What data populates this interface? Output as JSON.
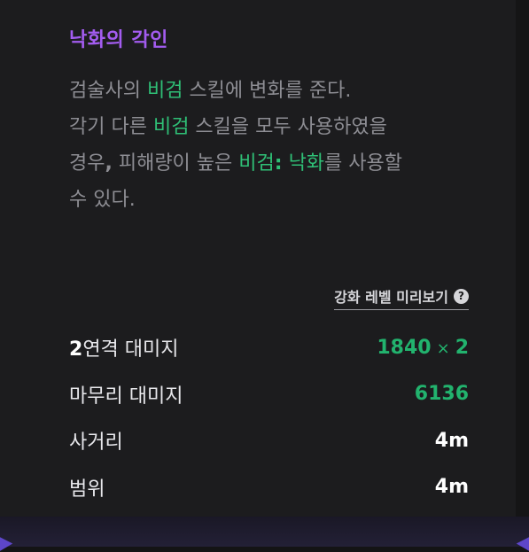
{
  "title": "낙화의 각인",
  "description": {
    "line1": [
      "검술사의 ",
      "비검",
      " 스킬에 변화를 준다."
    ],
    "line2": [
      "각기 다른 ",
      "비검",
      " 스킬을 모두 사용하였을"
    ],
    "line3": [
      "경우",
      ",",
      " 피해량이 높은 ",
      "비검",
      ":",
      " ",
      "낙화",
      "를 사용할"
    ],
    "line4": "수 있다."
  },
  "preview_link": {
    "label": "강화 레벨 미리보기",
    "icon": "?"
  },
  "stats": [
    {
      "label_num": "2",
      "label_rest": "연격 대미지",
      "value_main": "1840",
      "value_times": "×",
      "value_mult": "2"
    },
    {
      "label": "마무리 대미지",
      "value": "6136"
    },
    {
      "label": "사거리",
      "value": "4m"
    },
    {
      "label": "범위",
      "value": "4m"
    }
  ],
  "colors": {
    "title": "#a35cf0",
    "highlight": "#2fbf76",
    "value_green": "#22b36e",
    "text_muted": "#8d8d93",
    "background": "#1c1c1e"
  }
}
